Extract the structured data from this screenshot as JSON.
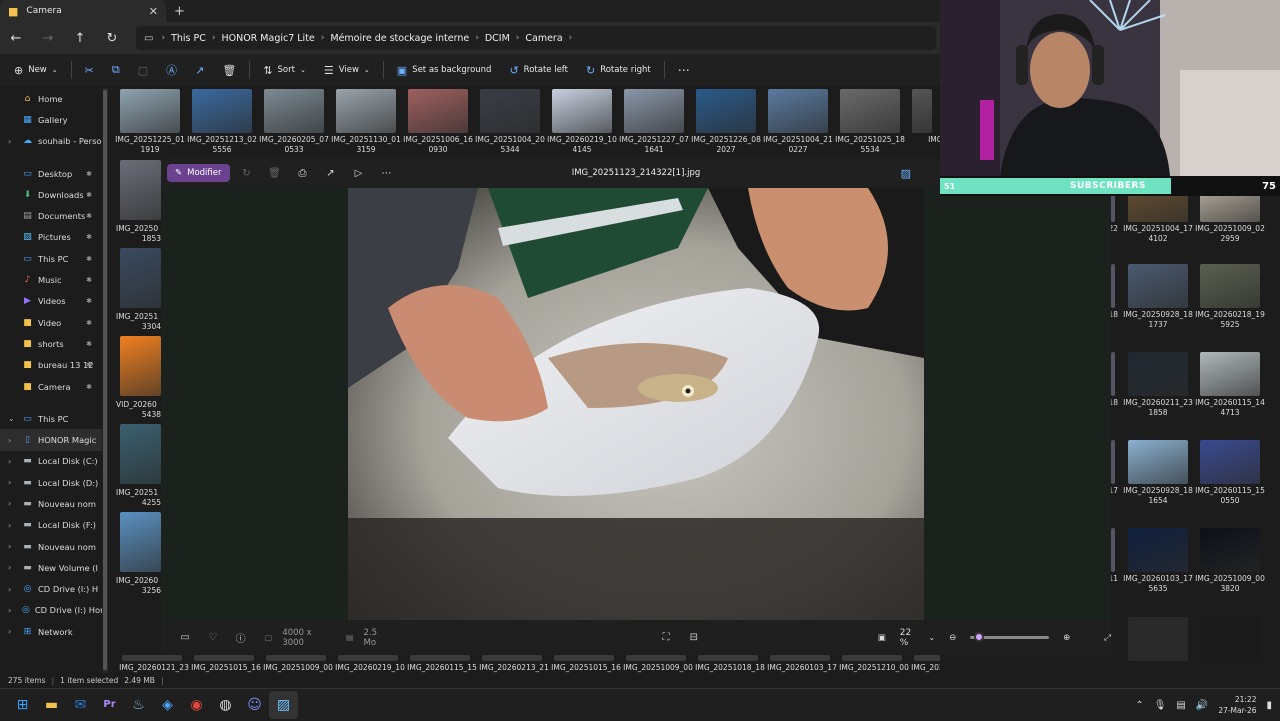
{
  "window": {
    "tab_title": "Camera"
  },
  "breadcrumbs": [
    "This PC",
    "HONOR Magic7 Lite",
    "Mémoire de stockage interne",
    "DCIM",
    "Camera"
  ],
  "commands": {
    "new": "New",
    "sort": "Sort",
    "view": "View",
    "set_background": "Set as background",
    "rotate_left": "Rotate left",
    "rotate_right": "Rotate right"
  },
  "sidebar": {
    "items": [
      {
        "label": "Home",
        "icon": "home-icon"
      },
      {
        "label": "Gallery",
        "icon": "gallery-icon"
      },
      {
        "label": "souhaib - Perso",
        "icon": "cloud-icon"
      },
      {
        "label": "Desktop",
        "icon": "desktop-icon"
      },
      {
        "label": "Downloads",
        "icon": "download-icon"
      },
      {
        "label": "Documents",
        "icon": "documents-icon"
      },
      {
        "label": "Pictures",
        "icon": "pictures-icon"
      },
      {
        "label": "This PC",
        "icon": "pc-icon"
      },
      {
        "label": "Music",
        "icon": "music-icon"
      },
      {
        "label": "Videos",
        "icon": "videos-icon"
      },
      {
        "label": "Video",
        "icon": "folder-icon"
      },
      {
        "label": "shorts",
        "icon": "folder-icon"
      },
      {
        "label": "bureau 13 12",
        "icon": "folder-icon"
      },
      {
        "label": "Camera",
        "icon": "folder-icon"
      },
      {
        "label": "This PC",
        "icon": "pc-icon"
      },
      {
        "label": "HONOR Magic",
        "icon": "phone-icon"
      },
      {
        "label": "Local Disk (C:)",
        "icon": "disk-icon"
      },
      {
        "label": "Local Disk (D:)",
        "icon": "disk-icon"
      },
      {
        "label": "Nouveau nom",
        "icon": "disk-icon"
      },
      {
        "label": "Local Disk (F:)",
        "icon": "disk-icon"
      },
      {
        "label": "Nouveau nom",
        "icon": "disk-icon"
      },
      {
        "label": "New Volume (I",
        "icon": "disk-icon"
      },
      {
        "label": "CD Drive (I:) H",
        "icon": "cd-icon"
      },
      {
        "label": "CD Drive (I:) Hor",
        "icon": "cd-icon"
      },
      {
        "label": "Network",
        "icon": "network-icon"
      }
    ]
  },
  "top_row": [
    {
      "l1": "IMG_20251225_01",
      "l2": "1919",
      "c": "#8fa3b0"
    },
    {
      "l1": "IMG_20251213_02",
      "l2": "5556",
      "c": "#3a6aa0"
    },
    {
      "l1": "IMG_20260205_07",
      "l2": "0533",
      "c": "#7d8a93"
    },
    {
      "l1": "IMG_20251130_01",
      "l2": "3159",
      "c": "#9aa4ac"
    },
    {
      "l1": "IMG_20251006_16",
      "l2": "0930",
      "c": "#a06060"
    },
    {
      "l1": "IMG_20251004_20",
      "l2": "5344",
      "c": "#3a3d45"
    },
    {
      "l1": "IMG_20260219_10",
      "l2": "4145",
      "c": "#c8d0e0"
    },
    {
      "l1": "IMG_20251227_07",
      "l2": "1641",
      "c": "#8a96a8"
    },
    {
      "l1": "IMG_20251226_08",
      "l2": "2027",
      "c": "#2a5a8a"
    },
    {
      "l1": "IMG_20251004_21",
      "l2": "0227",
      "c": "#5a7aa0"
    },
    {
      "l1": "IMG_20251025_18",
      "l2": "5534",
      "c": "#6a6a6a"
    },
    {
      "l1": "IMG_20",
      "l2": "2",
      "c": "#555"
    }
  ],
  "left_column": [
    {
      "l1": "IMG_20250",
      "l2": "1853",
      "c": "#6a6e78"
    },
    {
      "l1": "IMG_20251",
      "l2": "3304",
      "c": "#3a4a60"
    },
    {
      "l1": "VID_20260",
      "l2": "5438",
      "c": "#f08020"
    },
    {
      "l1": "IMG_20251",
      "l2": "4255",
      "c": "#3a6070"
    },
    {
      "l1": "IMG_20260",
      "l2": "3256",
      "c": "#5a90c0"
    }
  ],
  "right_column": [
    {
      "l1": "IMG_20251004_17",
      "l2": "4102",
      "c": "#6a5030",
      "l1b": "IMG_20251009_02",
      "l2b": "2959",
      "cb": "#c0b8a8",
      "side": "22"
    },
    {
      "l1": "IMG_20250928_18",
      "l2": "1737",
      "c": "#4a5a70",
      "l1b": "IMG_20260218_19",
      "l2b": "5925",
      "cb": "#5a6050",
      "side": "18"
    },
    {
      "l1": "IMG_20260211_23",
      "l2": "1858",
      "c": "#202830",
      "l1b": "IMG_20260115_14",
      "l2b": "4713",
      "cb": "#b0b8b8",
      "side": "18"
    },
    {
      "l1": "IMG_20250928_18",
      "l2": "1654",
      "c": "#8ab0d0",
      "l1b": "IMG_20260115_15",
      "l2b": "0550",
      "cb": "#3a4a90",
      "side": "17"
    },
    {
      "l1": "IMG_20260103_17",
      "l2": "5635",
      "c": "#102040",
      "l1b": "IMG_20251009_00",
      "l2b": "3820",
      "cb": "#0c1018",
      "side": "11"
    }
  ],
  "bottom_row": [
    "IMG_20260121_23",
    "IMG_20251015_16",
    "IMG_20251009_00",
    "IMG_20260219_10",
    "IMG_20260115_15",
    "IMG_20260213_21",
    "IMG_20251015_16",
    "IMG_20251009_00",
    "IMG_20251018_18",
    "IMG_20260103_17",
    "IMG_20251210_00",
    "IMG_20260218_20",
    "IMG_20251222_04",
    "IMG_20251018_18",
    "IMG_20251009_00",
    "IMG_20251209_13"
  ],
  "viewer": {
    "edit_label": "Modifier",
    "filename": "IMG_20251123_214322[1].jpg",
    "dimensions": "4000 x 3000",
    "filesize": "2.5 Mo",
    "zoom": "22 %",
    "zoom_fraction": 0.05
  },
  "status": {
    "count": "275 items",
    "selected": "1 item selected",
    "size": "2.49 MB"
  },
  "stream": {
    "left_count": "51",
    "label": "SUBSCRIBERS",
    "right_count": "75",
    "progress": 0.68
  },
  "clock": {
    "time": "21:22",
    "date": "27-Mar-26"
  }
}
